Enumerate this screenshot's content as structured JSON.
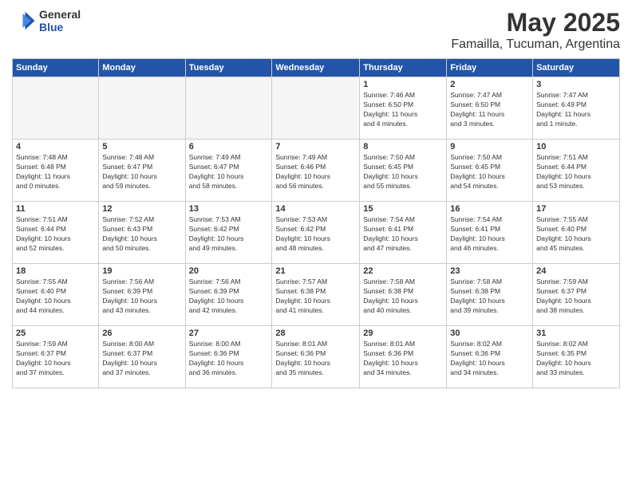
{
  "header": {
    "logo": {
      "line1": "General",
      "line2": "Blue"
    },
    "title": "May 2025",
    "subtitle": "Famailla, Tucuman, Argentina"
  },
  "weekdays": [
    "Sunday",
    "Monday",
    "Tuesday",
    "Wednesday",
    "Thursday",
    "Friday",
    "Saturday"
  ],
  "weeks": [
    [
      {
        "day": "",
        "info": ""
      },
      {
        "day": "",
        "info": ""
      },
      {
        "day": "",
        "info": ""
      },
      {
        "day": "",
        "info": ""
      },
      {
        "day": "1",
        "info": "Sunrise: 7:46 AM\nSunset: 6:50 PM\nDaylight: 11 hours\nand 4 minutes."
      },
      {
        "day": "2",
        "info": "Sunrise: 7:47 AM\nSunset: 6:50 PM\nDaylight: 11 hours\nand 3 minutes."
      },
      {
        "day": "3",
        "info": "Sunrise: 7:47 AM\nSunset: 6:49 PM\nDaylight: 11 hours\nand 1 minute."
      }
    ],
    [
      {
        "day": "4",
        "info": "Sunrise: 7:48 AM\nSunset: 6:48 PM\nDaylight: 11 hours\nand 0 minutes."
      },
      {
        "day": "5",
        "info": "Sunrise: 7:48 AM\nSunset: 6:47 PM\nDaylight: 10 hours\nand 59 minutes."
      },
      {
        "day": "6",
        "info": "Sunrise: 7:49 AM\nSunset: 6:47 PM\nDaylight: 10 hours\nand 58 minutes."
      },
      {
        "day": "7",
        "info": "Sunrise: 7:49 AM\nSunset: 6:46 PM\nDaylight: 10 hours\nand 56 minutes."
      },
      {
        "day": "8",
        "info": "Sunrise: 7:50 AM\nSunset: 6:45 PM\nDaylight: 10 hours\nand 55 minutes."
      },
      {
        "day": "9",
        "info": "Sunrise: 7:50 AM\nSunset: 6:45 PM\nDaylight: 10 hours\nand 54 minutes."
      },
      {
        "day": "10",
        "info": "Sunrise: 7:51 AM\nSunset: 6:44 PM\nDaylight: 10 hours\nand 53 minutes."
      }
    ],
    [
      {
        "day": "11",
        "info": "Sunrise: 7:51 AM\nSunset: 6:44 PM\nDaylight: 10 hours\nand 52 minutes."
      },
      {
        "day": "12",
        "info": "Sunrise: 7:52 AM\nSunset: 6:43 PM\nDaylight: 10 hours\nand 50 minutes."
      },
      {
        "day": "13",
        "info": "Sunrise: 7:53 AM\nSunset: 6:42 PM\nDaylight: 10 hours\nand 49 minutes."
      },
      {
        "day": "14",
        "info": "Sunrise: 7:53 AM\nSunset: 6:42 PM\nDaylight: 10 hours\nand 48 minutes."
      },
      {
        "day": "15",
        "info": "Sunrise: 7:54 AM\nSunset: 6:41 PM\nDaylight: 10 hours\nand 47 minutes."
      },
      {
        "day": "16",
        "info": "Sunrise: 7:54 AM\nSunset: 6:41 PM\nDaylight: 10 hours\nand 46 minutes."
      },
      {
        "day": "17",
        "info": "Sunrise: 7:55 AM\nSunset: 6:40 PM\nDaylight: 10 hours\nand 45 minutes."
      }
    ],
    [
      {
        "day": "18",
        "info": "Sunrise: 7:55 AM\nSunset: 6:40 PM\nDaylight: 10 hours\nand 44 minutes."
      },
      {
        "day": "19",
        "info": "Sunrise: 7:56 AM\nSunset: 6:39 PM\nDaylight: 10 hours\nand 43 minutes."
      },
      {
        "day": "20",
        "info": "Sunrise: 7:56 AM\nSunset: 6:39 PM\nDaylight: 10 hours\nand 42 minutes."
      },
      {
        "day": "21",
        "info": "Sunrise: 7:57 AM\nSunset: 6:38 PM\nDaylight: 10 hours\nand 41 minutes."
      },
      {
        "day": "22",
        "info": "Sunrise: 7:58 AM\nSunset: 6:38 PM\nDaylight: 10 hours\nand 40 minutes."
      },
      {
        "day": "23",
        "info": "Sunrise: 7:58 AM\nSunset: 6:38 PM\nDaylight: 10 hours\nand 39 minutes."
      },
      {
        "day": "24",
        "info": "Sunrise: 7:59 AM\nSunset: 6:37 PM\nDaylight: 10 hours\nand 38 minutes."
      }
    ],
    [
      {
        "day": "25",
        "info": "Sunrise: 7:59 AM\nSunset: 6:37 PM\nDaylight: 10 hours\nand 37 minutes."
      },
      {
        "day": "26",
        "info": "Sunrise: 8:00 AM\nSunset: 6:37 PM\nDaylight: 10 hours\nand 37 minutes."
      },
      {
        "day": "27",
        "info": "Sunrise: 8:00 AM\nSunset: 6:36 PM\nDaylight: 10 hours\nand 36 minutes."
      },
      {
        "day": "28",
        "info": "Sunrise: 8:01 AM\nSunset: 6:36 PM\nDaylight: 10 hours\nand 35 minutes."
      },
      {
        "day": "29",
        "info": "Sunrise: 8:01 AM\nSunset: 6:36 PM\nDaylight: 10 hours\nand 34 minutes."
      },
      {
        "day": "30",
        "info": "Sunrise: 8:02 AM\nSunset: 6:36 PM\nDaylight: 10 hours\nand 34 minutes."
      },
      {
        "day": "31",
        "info": "Sunrise: 8:02 AM\nSunset: 6:35 PM\nDaylight: 10 hours\nand 33 minutes."
      }
    ]
  ]
}
